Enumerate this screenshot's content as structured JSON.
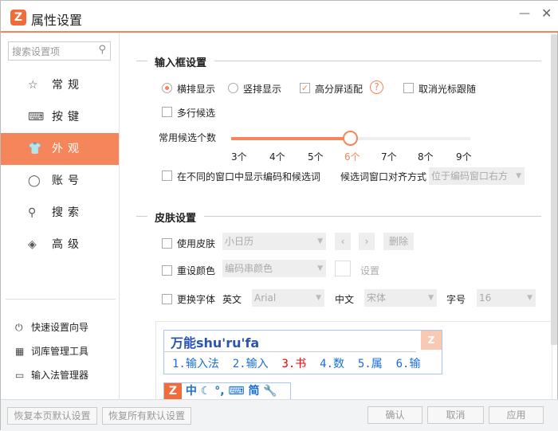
{
  "title": "属性设置",
  "search_placeholder": "搜索设置项",
  "nav": [
    {
      "icon": "star-icon",
      "label": "常规"
    },
    {
      "icon": "keyboard-icon",
      "label": "按键"
    },
    {
      "icon": "shirt-icon",
      "label": "外观"
    },
    {
      "icon": "user-icon",
      "label": "账号"
    },
    {
      "icon": "search-icon",
      "label": "搜索"
    },
    {
      "icon": "layers-icon",
      "label": "高级"
    }
  ],
  "tools": [
    "快速设置向导",
    "词库管理工具",
    "输入法管理器"
  ],
  "input_box": {
    "title": "输入框设置",
    "horizontal": "横排显示",
    "vertical": "竖排显示",
    "hidpi": "高分屏适配",
    "cancel_cursor": "取消光标跟随",
    "multiline": "多行候选",
    "count_label": "常用候选个数",
    "ticks": [
      "3个",
      "4个",
      "5个",
      "6个",
      "7个",
      "8个",
      "9个"
    ],
    "count_value": 6,
    "separate_window": "在不同的窗口中显示编码和候选词",
    "align_label": "候选词窗口对齐方式",
    "align_value": "位于编码窗口右方"
  },
  "skin": {
    "title": "皮肤设置",
    "use_skin": "使用皮肤",
    "skin_value": "小日历",
    "delete": "删除",
    "reset_color": "重设颜色",
    "color_value": "编码串颜色",
    "settings": "设置",
    "change_font": "更换字体",
    "en_label": "英文",
    "en_font": "Arial",
    "cn_label": "中文",
    "cn_font": "宋体",
    "size_label": "字号",
    "size_value": "16"
  },
  "preview": {
    "composition": "万能shu'ru'fa",
    "candidates": [
      "1.输入法",
      "2.输入",
      "3.书",
      "4.数",
      "5.属",
      "6.输"
    ],
    "toolbar": [
      "中",
      "简"
    ]
  },
  "footer": {
    "restore_page": "恢复本页默认设置",
    "restore_all": "恢复所有默认设置",
    "ok": "确认",
    "cancel": "取消",
    "apply": "应用"
  },
  "accent": "#f5855a"
}
